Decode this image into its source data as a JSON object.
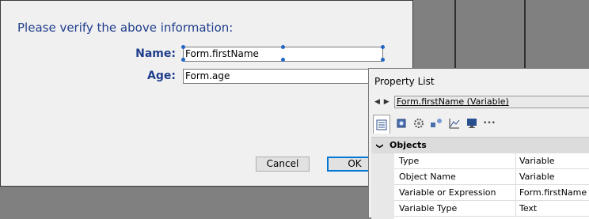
{
  "form": {
    "prompt": "Please verify the above information:",
    "fields": [
      {
        "label": "Name:",
        "value": "Form.firstName",
        "selected": true
      },
      {
        "label": "Age:",
        "value": "Form.age",
        "selected": false
      }
    ],
    "buttons": {
      "cancel": "Cancel",
      "ok": "OK"
    }
  },
  "property_list": {
    "title": "Property List",
    "nav": "◀ ▶",
    "selected_object": "Form.firstName (Variable)",
    "tabs": [
      {
        "icon": "properties-icon",
        "active": true
      },
      {
        "icon": "database-icon",
        "active": false
      },
      {
        "icon": "gear-icon",
        "active": false
      },
      {
        "icon": "shapes-icon",
        "active": false
      },
      {
        "icon": "chart-icon",
        "active": false
      },
      {
        "icon": "monitor-icon",
        "active": false
      },
      {
        "icon": "more-icon",
        "label": "•••",
        "active": false
      }
    ],
    "group": {
      "chevron": "❯",
      "label": "Objects"
    },
    "rows": [
      {
        "name": "Type",
        "value": "Variable"
      },
      {
        "name": "Object Name",
        "value": "Variable"
      },
      {
        "name": "Variable or Expression",
        "value": "Form.firstName"
      },
      {
        "name": "Variable Type",
        "value": "Text"
      }
    ]
  },
  "colors": {
    "accent": "#1f3e8c",
    "selection": "#2166c3",
    "default_button": "#0078d7"
  }
}
